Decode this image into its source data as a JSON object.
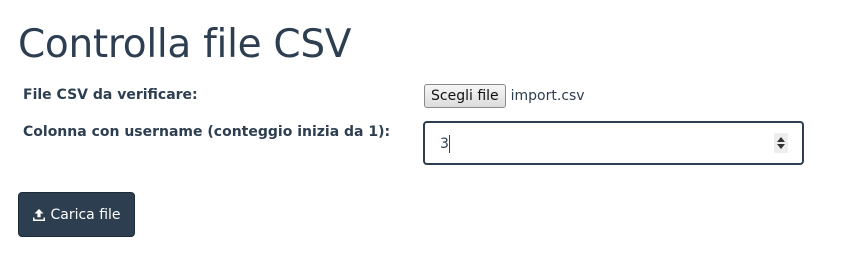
{
  "page": {
    "title": "Controlla file CSV"
  },
  "form": {
    "file_label": "File CSV da verificare:",
    "file_button_label": "Scegli file",
    "file_name": "import.csv",
    "column_label": "Colonna con username (conteggio inizia da 1):",
    "column_value": "3",
    "submit_label": "Carica file",
    "submit_icon": "upload-icon"
  },
  "colors": {
    "primary": "#2c3e50",
    "background": "#ffffff"
  }
}
